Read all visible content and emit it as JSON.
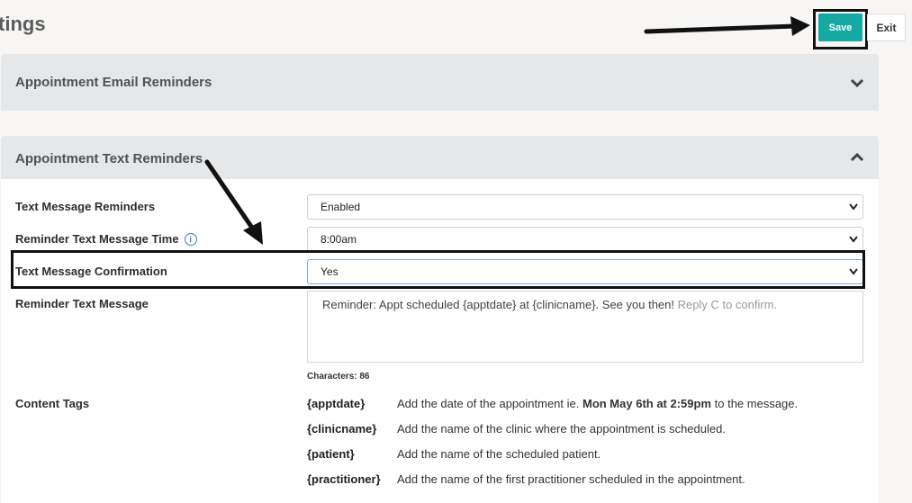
{
  "header": {
    "title": "tings",
    "save_label": "Save",
    "exit_label": "Exit"
  },
  "panels": {
    "email": {
      "title": "Appointment Email Reminders"
    },
    "text": {
      "title": "Appointment Text Reminders"
    }
  },
  "fields": {
    "reminders": {
      "label": "Text Message Reminders",
      "value": "Enabled"
    },
    "time": {
      "label": "Reminder Text Message Time",
      "value": "8:00am"
    },
    "confirmation": {
      "label": "Text Message Confirmation",
      "value": "Yes"
    },
    "message": {
      "label": "Reminder Text Message",
      "text": "Reminder: Appt scheduled {apptdate} at {clinicname}. See you then!",
      "suffix": "Reply C to confirm.",
      "chars": "Characters: 86"
    }
  },
  "content_tags": {
    "label": "Content Tags",
    "items": [
      {
        "tag": "{apptdate}",
        "desc_before": "Add the date of the appointment ie. ",
        "desc_bold": "Mon May 6th at 2:59pm",
        "desc_after": " to the message."
      },
      {
        "tag": "{clinicname}",
        "desc_before": "Add the name of the clinic where the appointment is scheduled.",
        "desc_bold": "",
        "desc_after": ""
      },
      {
        "tag": "{patient}",
        "desc_before": "Add the name of the scheduled patient.",
        "desc_bold": "",
        "desc_after": ""
      },
      {
        "tag": "{practitioner}",
        "desc_before": "Add the name of the first practitioner scheduled in the appointment.",
        "desc_bold": "",
        "desc_after": ""
      }
    ]
  },
  "colors": {
    "accent": "#14aaa3",
    "panel_header": "#e5e7e9",
    "info": "#3a7bd5"
  },
  "icons": [
    "chevron-down-icon",
    "chevron-up-icon",
    "info-icon",
    "select-caret-icon",
    "arrow-annotation"
  ]
}
